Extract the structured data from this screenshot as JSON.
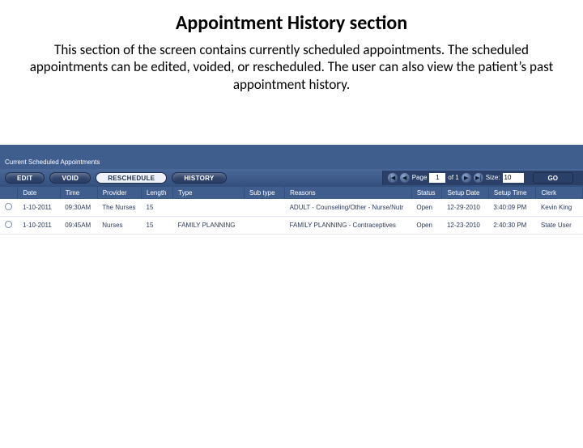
{
  "slide": {
    "title": "Appointment History section",
    "desc": "This section of the screen contains currently scheduled appointments. The scheduled appointments can be edited, voided, or rescheduled. The user can also view the patient’s past appointment history."
  },
  "section_label": "Current Scheduled Appointments",
  "buttons": {
    "edit": "EDIT",
    "void": "VOID",
    "resched": "RESCHEDULE",
    "history": "HISTORY",
    "go": "GO"
  },
  "pager": {
    "page_label": "Page",
    "page": "1",
    "of_text": "of 1",
    "size_label": "Size:",
    "size": "10"
  },
  "columns": {
    "date": "Date",
    "time": "Time",
    "provider": "Provider",
    "length": "Length",
    "type": "Type",
    "subtype": "Sub type",
    "reasons": "Reasons",
    "status": "Status",
    "setup_date": "Setup Date",
    "setup_time": "Setup Time",
    "clerk": "Clerk"
  },
  "rows": [
    {
      "date": "1-10-2011",
      "time": "09:30AM",
      "provider": "The Nurses",
      "length": "15",
      "type": "",
      "subtype": "",
      "reasons": "ADULT - Counseling/Other - Nurse/Nutr",
      "status": "Open",
      "setup_date": "12-29-2010",
      "setup_time": "3:40:09 PM",
      "clerk": "Kevin King"
    },
    {
      "date": "1-10-2011",
      "time": "09:45AM",
      "provider": "Nurses",
      "length": "15",
      "type": "FAMILY PLANNING",
      "subtype": "",
      "reasons": "FAMILY PLANNING - Contraceptives",
      "status": "Open",
      "setup_date": "12-23-2010",
      "setup_time": "2:40:30 PM",
      "clerk": "State User"
    }
  ]
}
